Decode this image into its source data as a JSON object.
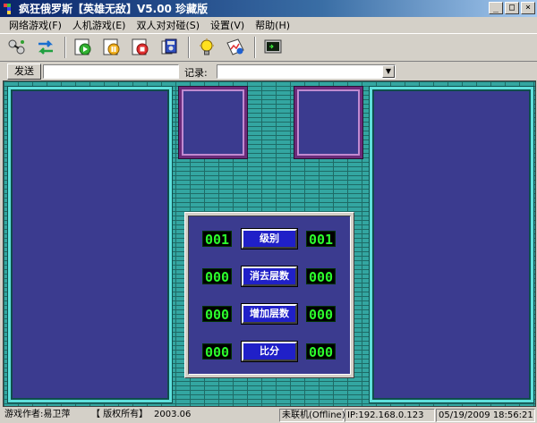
{
  "window": {
    "title": "疯狂俄罗斯【英雄无敌】V5.00 珍藏版",
    "minimize": "_",
    "maximize": "□",
    "close": "×"
  },
  "menu": [
    "网络游戏(F)",
    "人机游戏(E)",
    "双人对对碰(S)",
    "设置(V)",
    "帮助(H)"
  ],
  "toolbar": {
    "icons": [
      "connect-icon",
      "swap-icon",
      "play-icon",
      "pause-icon",
      "stop-icon",
      "save-icon",
      "tip-icon",
      "chart-icon",
      "monitor-icon"
    ]
  },
  "chat": {
    "send_label": "发送",
    "input_value": "",
    "record_label": "记录:",
    "record_value": ""
  },
  "score": {
    "rows": [
      {
        "label": "级别",
        "left": "001",
        "right": "001"
      },
      {
        "label": "消去层数",
        "left": "000",
        "right": "000"
      },
      {
        "label": "增加层数",
        "left": "000",
        "right": "000"
      },
      {
        "label": "比分",
        "left": "000",
        "right": "000"
      }
    ]
  },
  "status": {
    "author": "游戏作者:易卫萍",
    "copyright": "【 版权所有】",
    "year": "2003.06",
    "mode": "未联机(Offline)",
    "ip": "IP:192.168.0.123",
    "datetime": "05/19/2009 18:56:21"
  },
  "colors": {
    "board": "#3b3b8f",
    "brick": "#33a6a1",
    "lcd_text": "#2cff2c",
    "score_button": "#2020c8"
  }
}
